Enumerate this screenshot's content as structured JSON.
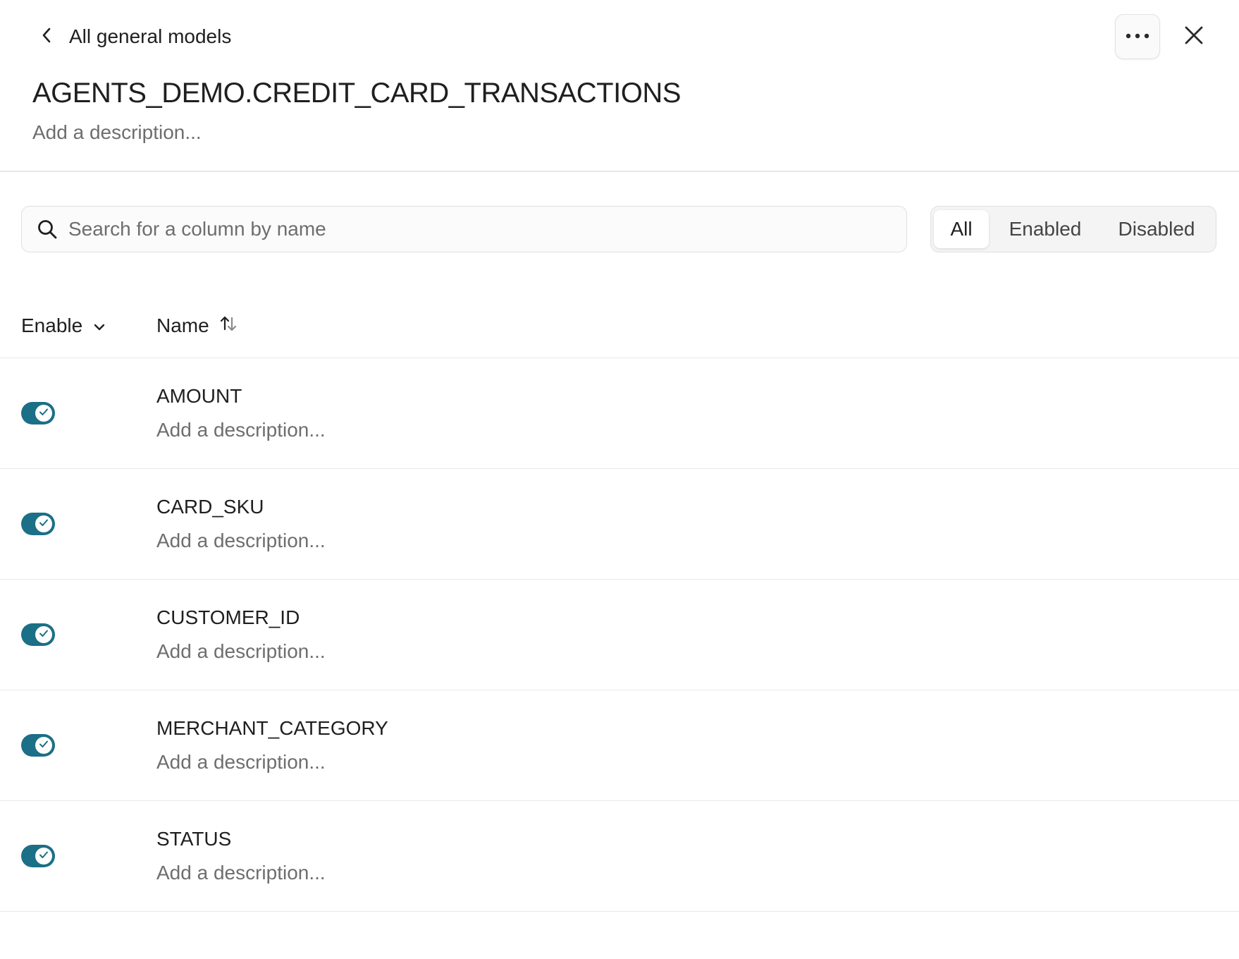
{
  "header": {
    "back_label": "All general models",
    "title": "AGENTS_DEMO.CREDIT_CARD_TRANSACTIONS",
    "description_placeholder": "Add a description...",
    "icons": {
      "back": "chevron-left-icon",
      "more": "more-horizontal-icon",
      "close": "close-icon"
    }
  },
  "toolbar": {
    "search_placeholder": "Search for a column by name",
    "search_value": "",
    "filters": [
      {
        "label": "All",
        "active": true
      },
      {
        "label": "Enabled",
        "active": false
      },
      {
        "label": "Disabled",
        "active": false
      }
    ]
  },
  "table": {
    "columns": [
      {
        "label": "Enable",
        "icon": "chevron-down-icon"
      },
      {
        "label": "Name",
        "icon": "sort-icon"
      }
    ],
    "rows": [
      {
        "name": "AMOUNT",
        "description": "Add a description...",
        "enabled": true
      },
      {
        "name": "CARD_SKU",
        "description": "Add a description...",
        "enabled": true
      },
      {
        "name": "CUSTOMER_ID",
        "description": "Add a description...",
        "enabled": true
      },
      {
        "name": "MERCHANT_CATEGORY",
        "description": "Add a description...",
        "enabled": true
      },
      {
        "name": "STATUS",
        "description": "Add a description...",
        "enabled": true
      }
    ]
  },
  "colors": {
    "toggle_on": "#1b6f86",
    "text_primary": "#1f1f1f",
    "text_muted": "#6e6e6e",
    "divider": "#e8e8e8"
  }
}
